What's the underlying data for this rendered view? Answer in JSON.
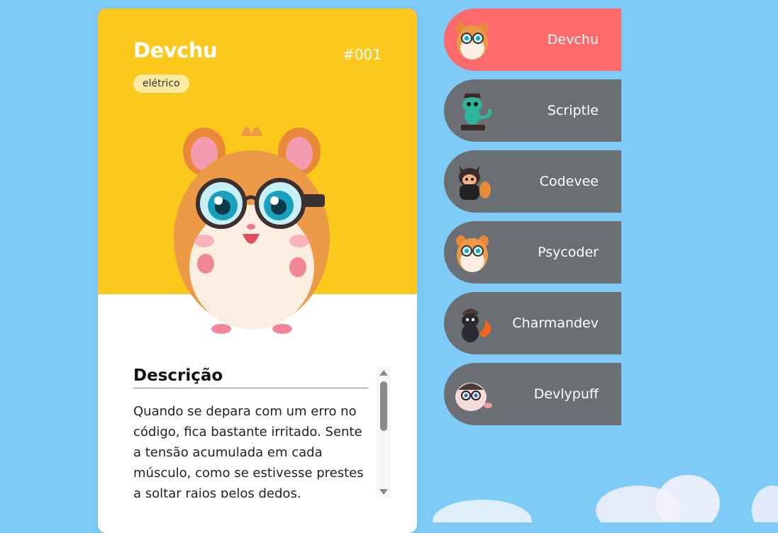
{
  "card": {
    "name": "Devchu",
    "number": "#001",
    "type": "elétrico",
    "description_title": "Descrição",
    "description": "Quando se depara com um erro no código, fica bastante irritado. Sente a tensão acumulada em cada músculo, como se estivesse prestes a soltar raios pelos dedos."
  },
  "characters": [
    {
      "label": "Devchu",
      "active": true
    },
    {
      "label": "Scriptle",
      "active": false
    },
    {
      "label": "Codevee",
      "active": false
    },
    {
      "label": "Psycoder",
      "active": false
    },
    {
      "label": "Charmandev",
      "active": false
    },
    {
      "label": "Devlypuff",
      "active": false
    }
  ],
  "colors": {
    "background": "#7ecbf7",
    "card_top": "#fcc81c",
    "active_item": "#fd6a6c",
    "inactive_item": "#6b6e73",
    "type_badge": "#fdeaa1"
  },
  "icons": {
    "hero": "hamster-with-glasses",
    "avatars": [
      "hamster-icon",
      "lizard-icon",
      "cat-icon",
      "hamster-icon",
      "dino-icon",
      "puffball-icon"
    ]
  }
}
